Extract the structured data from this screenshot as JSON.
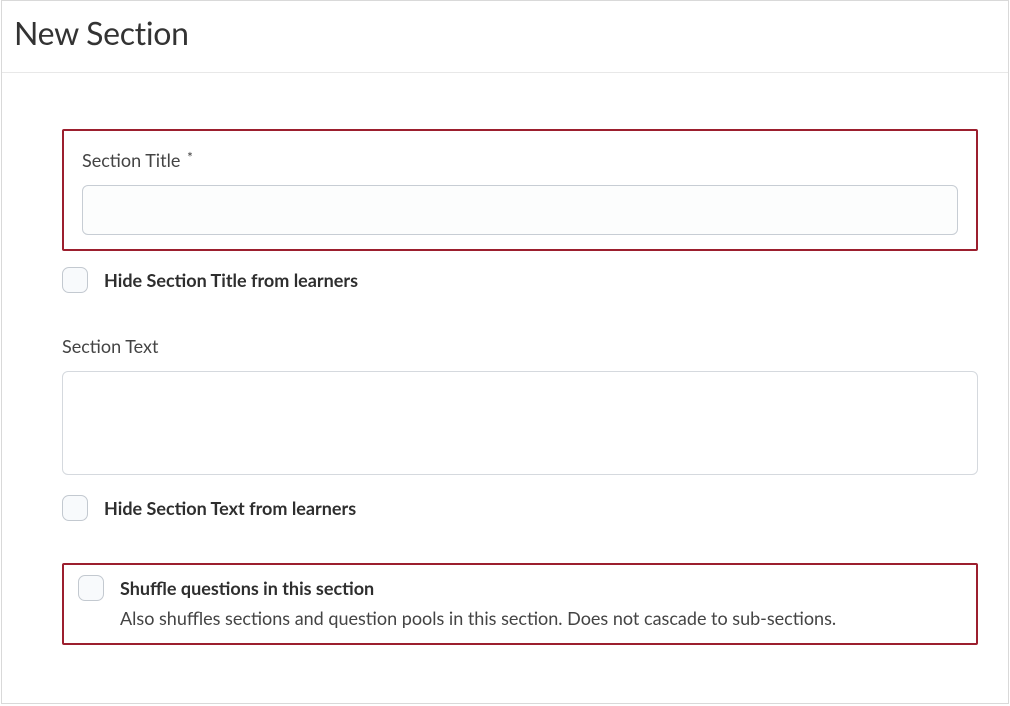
{
  "header": {
    "title": "New Section"
  },
  "form": {
    "section_title_label": "Section Title",
    "section_title_required_mark": "*",
    "section_title_value": "",
    "hide_title_label": "Hide Section Title from learners",
    "section_text_label": "Section Text",
    "section_text_value": "",
    "hide_text_label": "Hide Section Text from learners",
    "shuffle_label": "Shuffle questions in this section",
    "shuffle_help": "Also shuffles sections and question pools in this section. Does not cascade to sub-sections."
  }
}
